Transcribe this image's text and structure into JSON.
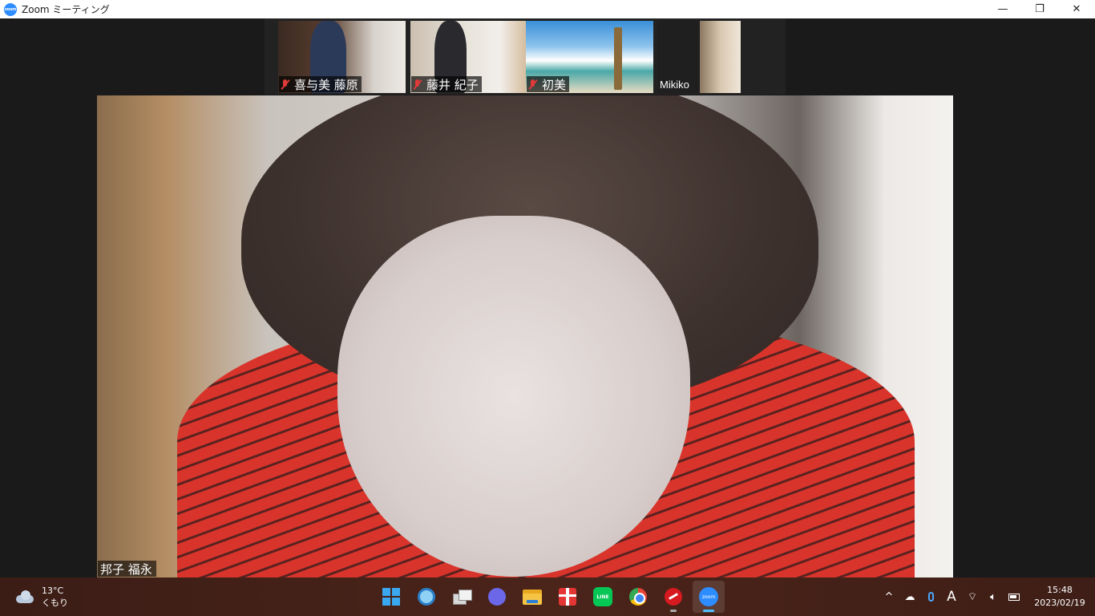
{
  "window": {
    "title": "Zoom ミーティング",
    "app_icon_text": "zoom",
    "controls": {
      "minimize": "—",
      "restore": "❐",
      "close": "✕"
    }
  },
  "gallery": [
    {
      "name": "喜与美 藤原",
      "muted": true
    },
    {
      "name": "藤井 紀子",
      "muted": true
    },
    {
      "name": "初美",
      "muted": true
    },
    {
      "name": "Mikiko",
      "muted": false
    }
  ],
  "main_speaker": {
    "name": "邦子 福永"
  },
  "taskbar": {
    "weather": {
      "temp": "13°C",
      "condition": "くもり",
      "icon": "cloud-icon"
    },
    "apps": [
      {
        "name": "start",
        "icon": "windows-start-icon"
      },
      {
        "name": "search",
        "icon": "search-icon"
      },
      {
        "name": "task-view",
        "icon": "task-view-icon"
      },
      {
        "name": "chat",
        "icon": "chat-icon"
      },
      {
        "name": "file-explorer",
        "icon": "folder-icon"
      },
      {
        "name": "gift",
        "icon": "gift-icon"
      },
      {
        "name": "line",
        "icon": "line-icon",
        "label": "LINE"
      },
      {
        "name": "chrome",
        "icon": "chrome-icon"
      },
      {
        "name": "trend-micro",
        "icon": "trend-micro-icon"
      },
      {
        "name": "zoom",
        "icon": "zoom-icon",
        "label": "zoom",
        "active": true
      }
    ],
    "tray": {
      "chevron": "^",
      "ime": "A",
      "time": "15:48",
      "date": "2023/02/19"
    }
  },
  "colors": {
    "accent": "#2d8cff",
    "mute_red": "#e03a3a",
    "taskbar": "#4b241a"
  }
}
